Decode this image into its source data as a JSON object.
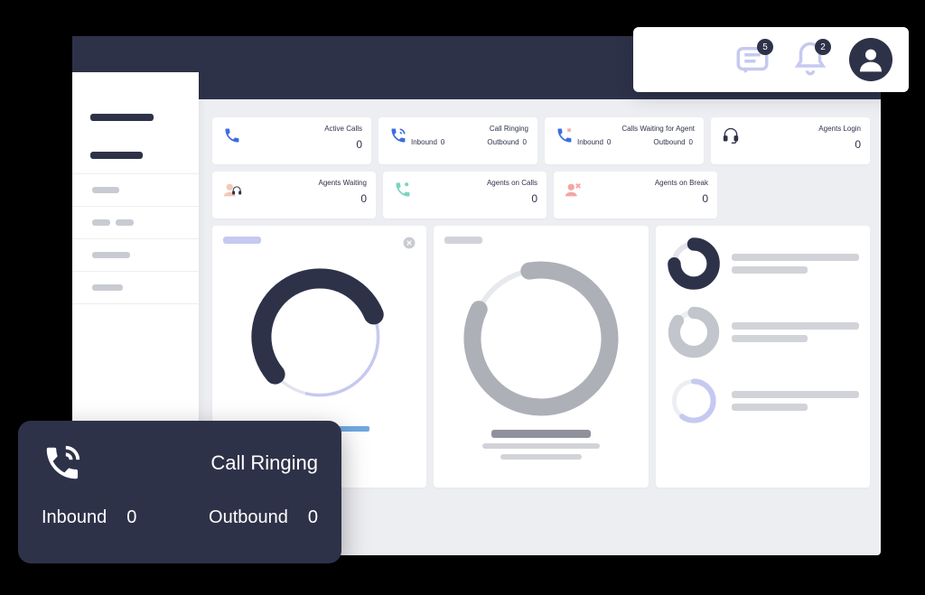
{
  "header": {
    "messages_badge": "5",
    "notifications_badge": "2"
  },
  "metrics": {
    "active_calls": {
      "title": "Active Calls",
      "value": "0"
    },
    "call_ringing": {
      "title": "Call Ringing",
      "inbound_label": "Inbound",
      "inbound_value": "0",
      "outbound_label": "Outbound",
      "outbound_value": "0"
    },
    "calls_waiting": {
      "title": "Calls Waiting for Agent",
      "inbound_label": "Inbound",
      "inbound_value": "0",
      "outbound_label": "Outbound",
      "outbound_value": "0"
    },
    "agents_login": {
      "title": "Agents Login",
      "value": "0"
    },
    "agents_waiting": {
      "title": "Agents Waiting",
      "value": "0"
    },
    "agents_on_calls": {
      "title": "Agents on Calls",
      "value": "0"
    },
    "agents_on_break": {
      "title": "Agents on Break",
      "value": "0"
    }
  },
  "overlay_card": {
    "title": "Call Ringing",
    "inbound_label": "Inbound",
    "inbound_value": "0",
    "outbound_label": "Outbound",
    "outbound_value": "0"
  },
  "chart_data": [
    {
      "type": "donut",
      "title": "",
      "series": [
        {
          "name": "primary",
          "value": 55,
          "color": "#2e3249"
        },
        {
          "name": "remainder",
          "value": 45,
          "color": "#c6c9f0"
        }
      ]
    },
    {
      "type": "donut",
      "title": "",
      "series": [
        {
          "name": "primary",
          "value": 85,
          "color": "#aeb0b8"
        },
        {
          "name": "remainder",
          "value": 15,
          "color": "#eceef2"
        }
      ]
    },
    {
      "type": "donut",
      "title": "",
      "series": [
        {
          "name": "primary",
          "value": 75,
          "color": "#2e3249"
        },
        {
          "name": "remainder",
          "value": 25,
          "color": "#d2d3d8"
        }
      ]
    },
    {
      "type": "donut",
      "title": "",
      "series": [
        {
          "name": "primary",
          "value": 85,
          "color": "#c3c5cc"
        },
        {
          "name": "remainder",
          "value": 15,
          "color": "#eceef2"
        }
      ]
    },
    {
      "type": "donut",
      "title": "",
      "series": [
        {
          "name": "primary",
          "value": 60,
          "color": "#c6c9f0"
        },
        {
          "name": "remainder",
          "value": 40,
          "color": "#eceef2"
        }
      ]
    }
  ]
}
